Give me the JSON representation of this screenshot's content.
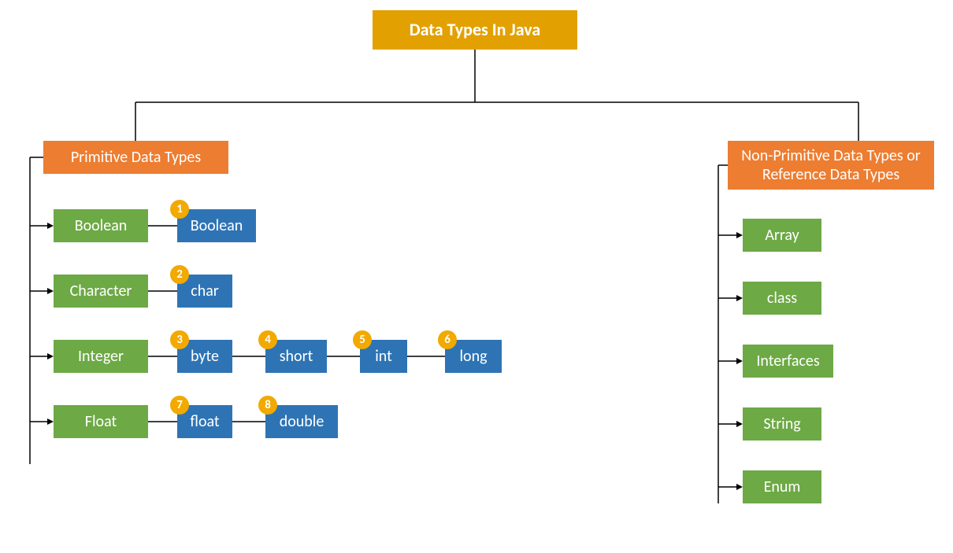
{
  "title": "Data Types In Java",
  "primitive": {
    "header": "Primitive Data Types",
    "categories": [
      {
        "name": "Boolean",
        "items": [
          {
            "num": "1",
            "label": "Boolean"
          }
        ]
      },
      {
        "name": "Character",
        "items": [
          {
            "num": "2",
            "label": "char"
          }
        ]
      },
      {
        "name": "Integer",
        "items": [
          {
            "num": "3",
            "label": "byte"
          },
          {
            "num": "4",
            "label": "short"
          },
          {
            "num": "5",
            "label": "int"
          },
          {
            "num": "6",
            "label": "long"
          }
        ]
      },
      {
        "name": "Float",
        "items": [
          {
            "num": "7",
            "label": "float"
          },
          {
            "num": "8",
            "label": "double"
          }
        ]
      }
    ]
  },
  "nonPrimitive": {
    "header": "Non-Primitive Data Types or Reference Data Types",
    "items": [
      "Array",
      "class",
      "Interfaces",
      "String",
      "Enum"
    ]
  }
}
